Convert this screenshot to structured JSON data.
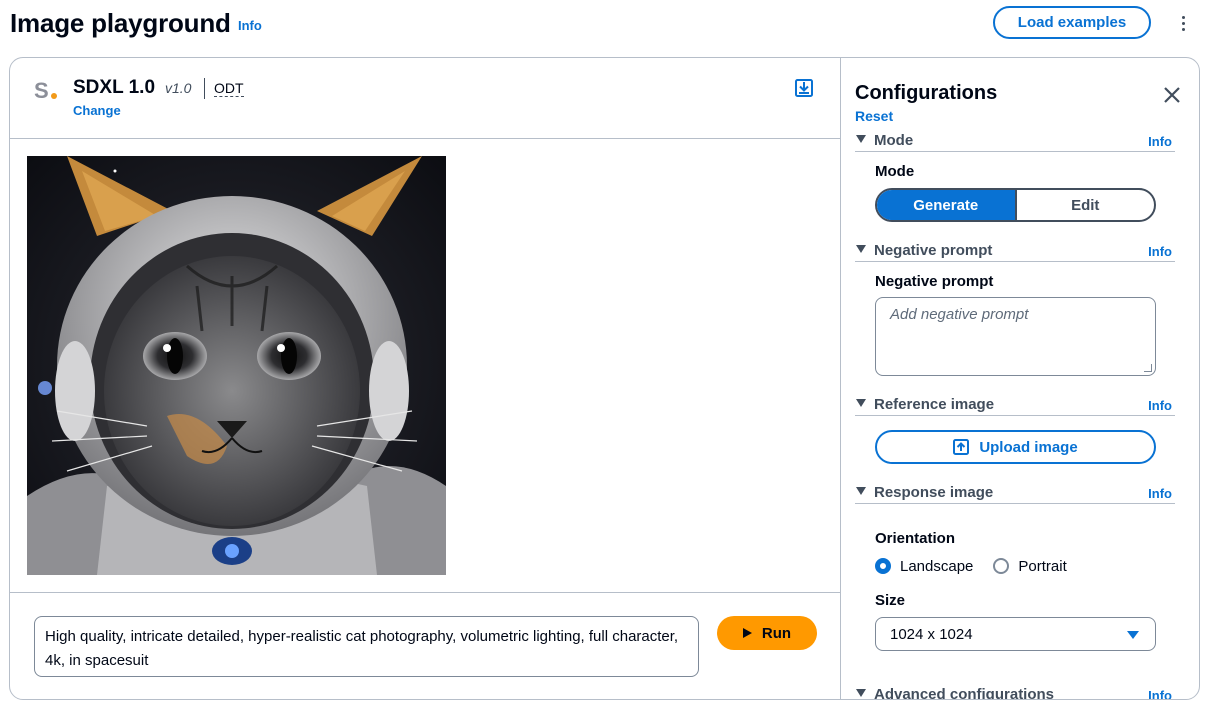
{
  "page": {
    "title": "Image playground",
    "info_label": "Info",
    "load_examples_label": "Load examples"
  },
  "model": {
    "logo_letter": "S",
    "name": "SDXL 1.0",
    "version": "v1.0",
    "provider": "ODT",
    "change_label": "Change"
  },
  "prompt": {
    "value": "High quality, intricate detailed, hyper-realistic cat photography, volumetric lighting, full character, 4k, in spacesuit",
    "run_label": "Run"
  },
  "config": {
    "title": "Configurations",
    "reset_label": "Reset",
    "sections": {
      "mode": {
        "header": "Mode",
        "info": "Info",
        "field_label": "Mode",
        "options": [
          "Generate",
          "Edit"
        ],
        "selected": "Generate"
      },
      "negative": {
        "header": "Negative prompt",
        "info": "Info",
        "field_label": "Negative prompt",
        "placeholder": "Add negative prompt"
      },
      "reference": {
        "header": "Reference image",
        "info": "Info",
        "upload_label": "Upload image"
      },
      "response": {
        "header": "Response image",
        "info": "Info",
        "orientation_label": "Orientation",
        "orientation_options": [
          "Landscape",
          "Portrait"
        ],
        "orientation_selected": "Landscape",
        "size_label": "Size",
        "size_value": "1024 x 1024"
      },
      "advanced": {
        "header": "Advanced configurations",
        "info": "Info"
      }
    }
  },
  "colors": {
    "accent": "#0972d3",
    "run_button": "#ff9900",
    "border": "#b6bec9"
  },
  "icons": [
    "kebab-menu-icon",
    "download-icon",
    "close-icon",
    "caret-down-icon",
    "upload-icon",
    "play-icon",
    "dropdown-arrow-icon"
  ]
}
